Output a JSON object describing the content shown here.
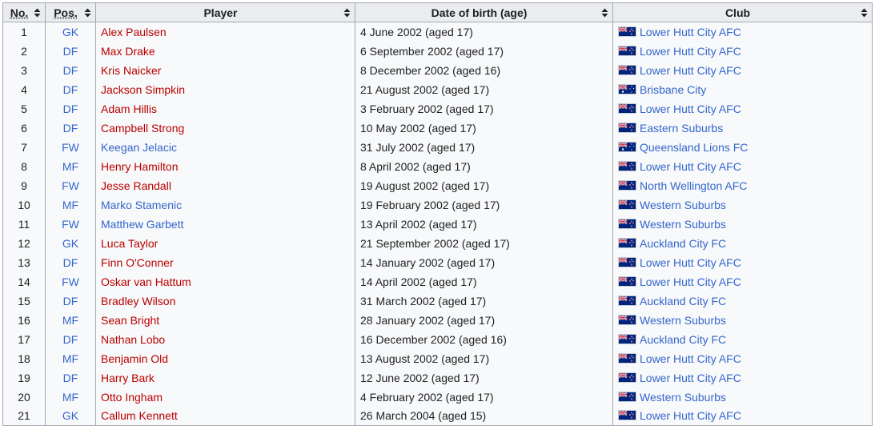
{
  "headers": {
    "no": "No.",
    "pos": "Pos.",
    "player": "Player",
    "dob": "Date of birth (age)",
    "club": "Club"
  },
  "rows": [
    {
      "no": "1",
      "pos": "GK",
      "player": "Alex Paulsen",
      "player_link": "red",
      "dob": "4 June 2002 (aged 17)",
      "club": "Lower Hutt City AFC",
      "flag": "nz-flag"
    },
    {
      "no": "2",
      "pos": "DF",
      "player": "Max Drake",
      "player_link": "red",
      "dob": "6 September 2002 (aged 17)",
      "club": "Lower Hutt City AFC",
      "flag": "nz-flag"
    },
    {
      "no": "3",
      "pos": "DF",
      "player": "Kris Naicker",
      "player_link": "red",
      "dob": "8 December 2002 (aged 16)",
      "club": "Lower Hutt City AFC",
      "flag": "nz-flag"
    },
    {
      "no": "4",
      "pos": "DF",
      "player": "Jackson Simpkin",
      "player_link": "red",
      "dob": "21 August 2002 (aged 17)",
      "club": "Brisbane City",
      "flag": "au-flag"
    },
    {
      "no": "5",
      "pos": "DF",
      "player": "Adam Hillis",
      "player_link": "red",
      "dob": "3 February 2002 (aged 17)",
      "club": "Lower Hutt City AFC",
      "flag": "nz-flag"
    },
    {
      "no": "6",
      "pos": "DF",
      "player": "Campbell Strong",
      "player_link": "red",
      "dob": "10 May 2002 (aged 17)",
      "club": "Eastern Suburbs",
      "flag": "nz-flag"
    },
    {
      "no": "7",
      "pos": "FW",
      "player": "Keegan Jelacic",
      "player_link": "blue",
      "dob": "31 July 2002 (aged 17)",
      "club": "Queensland Lions FC",
      "flag": "au-flag"
    },
    {
      "no": "8",
      "pos": "MF",
      "player": "Henry Hamilton",
      "player_link": "red",
      "dob": "8 April 2002 (aged 17)",
      "club": "Lower Hutt City AFC",
      "flag": "nz-flag"
    },
    {
      "no": "9",
      "pos": "FW",
      "player": "Jesse Randall",
      "player_link": "red",
      "dob": "19 August 2002 (aged 17)",
      "club": "North Wellington AFC",
      "flag": "nz-flag"
    },
    {
      "no": "10",
      "pos": "MF",
      "player": "Marko Stamenic",
      "player_link": "blue",
      "dob": "19 February 2002 (aged 17)",
      "club": "Western Suburbs",
      "flag": "nz-flag"
    },
    {
      "no": "11",
      "pos": "FW",
      "player": "Matthew Garbett",
      "player_link": "blue",
      "dob": "13 April 2002 (aged 17)",
      "club": "Western Suburbs",
      "flag": "nz-flag"
    },
    {
      "no": "12",
      "pos": "GK",
      "player": "Luca Taylor",
      "player_link": "red",
      "dob": "21 September 2002 (aged 17)",
      "club": "Auckland City FC",
      "flag": "nz-flag"
    },
    {
      "no": "13",
      "pos": "DF",
      "player": "Finn O'Conner",
      "player_link": "red",
      "dob": "14 January 2002 (aged 17)",
      "club": "Lower Hutt City AFC",
      "flag": "nz-flag"
    },
    {
      "no": "14",
      "pos": "FW",
      "player": "Oskar van Hattum",
      "player_link": "red",
      "dob": "14 April 2002 (aged 17)",
      "club": "Lower Hutt City AFC",
      "flag": "nz-flag"
    },
    {
      "no": "15",
      "pos": "DF",
      "player": "Bradley Wilson",
      "player_link": "red",
      "dob": "31 March 2002 (aged 17)",
      "club": "Auckland City FC",
      "flag": "nz-flag"
    },
    {
      "no": "16",
      "pos": "MF",
      "player": "Sean Bright",
      "player_link": "red",
      "dob": "28 January 2002 (aged 17)",
      "club": "Western Suburbs",
      "flag": "nz-flag"
    },
    {
      "no": "17",
      "pos": "DF",
      "player": "Nathan Lobo",
      "player_link": "red",
      "dob": "16 December 2002 (aged 16)",
      "club": "Auckland City FC",
      "flag": "nz-flag"
    },
    {
      "no": "18",
      "pos": "MF",
      "player": "Benjamin Old",
      "player_link": "red",
      "dob": "13 August 2002 (aged 17)",
      "club": "Lower Hutt City AFC",
      "flag": "nz-flag"
    },
    {
      "no": "19",
      "pos": "DF",
      "player": "Harry Bark",
      "player_link": "red",
      "dob": "12 June 2002 (aged 17)",
      "club": "Lower Hutt City AFC",
      "flag": "nz-flag"
    },
    {
      "no": "20",
      "pos": "MF",
      "player": "Otto Ingham",
      "player_link": "red",
      "dob": "4 February 2002 (aged 17)",
      "club": "Western Suburbs",
      "flag": "nz-flag"
    },
    {
      "no": "21",
      "pos": "GK",
      "player": "Callum Kennett",
      "player_link": "red",
      "dob": "26 March 2004 (aged 15)",
      "club": "Lower Hutt City AFC",
      "flag": "nz-flag"
    }
  ],
  "colors": {
    "red_link": "#ba0000",
    "blue_link": "#3366cc",
    "header_bg": "#eaecf0",
    "table_bg": "#f8f9fa",
    "border": "#a2a9b1"
  }
}
